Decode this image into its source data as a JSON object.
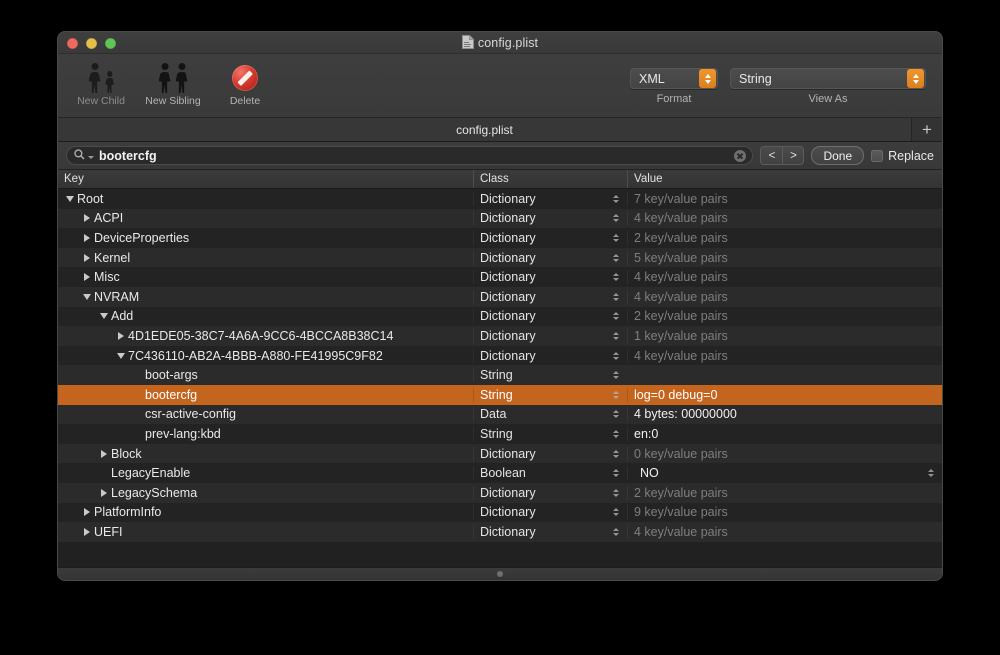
{
  "window": {
    "title": "config.plist",
    "title_icon": "document-icon",
    "traffic_lights": {
      "close": "close-window-button",
      "minimize": "minimize-window-button",
      "zoom": "zoom-window-button"
    }
  },
  "toolbar": {
    "buttons": [
      {
        "label": "New Child",
        "icon": "two-persons-parent-child-icon",
        "enabled": false
      },
      {
        "label": "New Sibling",
        "icon": "two-persons-equal-icon",
        "enabled": true
      },
      {
        "label": "Delete",
        "icon": "prohibition-sign-icon",
        "enabled": true
      }
    ],
    "popups": [
      {
        "label": "Format",
        "value": "XML",
        "stepper_icon": "up-down-stepper-icon"
      },
      {
        "label": "View As",
        "value": "String",
        "stepper_icon": "up-down-stepper-icon"
      }
    ],
    "accent_color": "#e2841f"
  },
  "tabbar": {
    "active_tab": "config.plist",
    "add_tab_label": "+"
  },
  "findbar": {
    "search_icon": "search-icon",
    "search_dropdown_icon": "chevron-down-icon",
    "search_value": "bootercfg",
    "search_placeholder": "Search",
    "clear_icon": "clear-circle-icon",
    "prev_label": "<",
    "next_label": ">",
    "done_label": "Done",
    "replace_label": "Replace",
    "replace_checked": false
  },
  "table": {
    "columns": [
      "Key",
      "Class",
      "Value"
    ],
    "selection_color": "#c4651f",
    "rows": [
      {
        "key": "Root",
        "depth": 0,
        "disclosure": "open",
        "class": "Dictionary",
        "value": "7 key/value pairs",
        "muted": true,
        "selected": false,
        "value_stepper": false
      },
      {
        "key": "ACPI",
        "depth": 1,
        "disclosure": "closed",
        "class": "Dictionary",
        "value": "4 key/value pairs",
        "muted": true,
        "selected": false,
        "value_stepper": false
      },
      {
        "key": "DeviceProperties",
        "depth": 1,
        "disclosure": "closed",
        "class": "Dictionary",
        "value": "2 key/value pairs",
        "muted": true,
        "selected": false,
        "value_stepper": false
      },
      {
        "key": "Kernel",
        "depth": 1,
        "disclosure": "closed",
        "class": "Dictionary",
        "value": "5 key/value pairs",
        "muted": true,
        "selected": false,
        "value_stepper": false
      },
      {
        "key": "Misc",
        "depth": 1,
        "disclosure": "closed",
        "class": "Dictionary",
        "value": "4 key/value pairs",
        "muted": true,
        "selected": false,
        "value_stepper": false
      },
      {
        "key": "NVRAM",
        "depth": 1,
        "disclosure": "open",
        "class": "Dictionary",
        "value": "4 key/value pairs",
        "muted": true,
        "selected": false,
        "value_stepper": false
      },
      {
        "key": "Add",
        "depth": 2,
        "disclosure": "open",
        "class": "Dictionary",
        "value": "2 key/value pairs",
        "muted": true,
        "selected": false,
        "value_stepper": false
      },
      {
        "key": "4D1EDE05-38C7-4A6A-9CC6-4BCCA8B38C14",
        "depth": 3,
        "disclosure": "closed",
        "class": "Dictionary",
        "value": "1 key/value pairs",
        "muted": true,
        "selected": false,
        "value_stepper": false
      },
      {
        "key": "7C436110-AB2A-4BBB-A880-FE41995C9F82",
        "depth": 3,
        "disclosure": "open",
        "class": "Dictionary",
        "value": "4 key/value pairs",
        "muted": true,
        "selected": false,
        "value_stepper": false
      },
      {
        "key": "boot-args",
        "depth": 4,
        "disclosure": "none",
        "class": "String",
        "value": "",
        "muted": false,
        "selected": false,
        "value_stepper": false
      },
      {
        "key": "bootercfg",
        "depth": 4,
        "disclosure": "none",
        "class": "String",
        "value": "log=0 debug=0",
        "muted": false,
        "selected": true,
        "value_stepper": false
      },
      {
        "key": "csr-active-config",
        "depth": 4,
        "disclosure": "none",
        "class": "Data",
        "value": "4 bytes: 00000000",
        "muted": false,
        "selected": false,
        "value_stepper": false
      },
      {
        "key": "prev-lang:kbd",
        "depth": 4,
        "disclosure": "none",
        "class": "String",
        "value": "en:0",
        "muted": false,
        "selected": false,
        "value_stepper": false
      },
      {
        "key": "Block",
        "depth": 2,
        "disclosure": "closed",
        "class": "Dictionary",
        "value": "0 key/value pairs",
        "muted": true,
        "selected": false,
        "value_stepper": false
      },
      {
        "key": "LegacyEnable",
        "depth": 2,
        "disclosure": "none",
        "class": "Boolean",
        "value": "NO",
        "muted": false,
        "selected": false,
        "value_stepper": true
      },
      {
        "key": "LegacySchema",
        "depth": 2,
        "disclosure": "closed",
        "class": "Dictionary",
        "value": "2 key/value pairs",
        "muted": true,
        "selected": false,
        "value_stepper": false
      },
      {
        "key": "PlatformInfo",
        "depth": 1,
        "disclosure": "closed",
        "class": "Dictionary",
        "value": "9 key/value pairs",
        "muted": true,
        "selected": false,
        "value_stepper": false
      },
      {
        "key": "UEFI",
        "depth": 1,
        "disclosure": "closed",
        "class": "Dictionary",
        "value": "4 key/value pairs",
        "muted": true,
        "selected": false,
        "value_stepper": false
      }
    ]
  },
  "statusbar": {
    "grip_icon": "resize-grip-dot-icon"
  }
}
